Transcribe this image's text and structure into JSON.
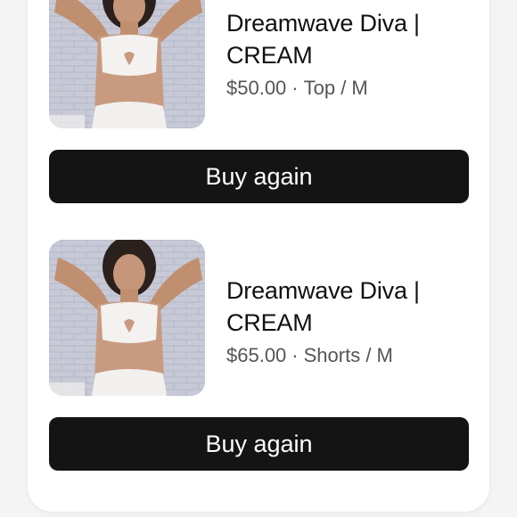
{
  "orders": [
    {
      "title": "Dreamwave Diva | CREAM",
      "price": "$50.00",
      "separator": "·",
      "variant": "Top / M",
      "button_label": "Buy again",
      "image_icon": "product-photo"
    },
    {
      "title": "Dreamwave Diva | CREAM",
      "price": "$65.00",
      "separator": "·",
      "variant": "Shorts / M",
      "button_label": "Buy again",
      "image_icon": "product-photo"
    }
  ],
  "colors": {
    "button_bg": "#141414",
    "button_text": "#ffffff",
    "title_text": "#111111",
    "meta_text": "#555559",
    "card_bg": "#ffffff",
    "page_bg": "#f4f4f5"
  }
}
